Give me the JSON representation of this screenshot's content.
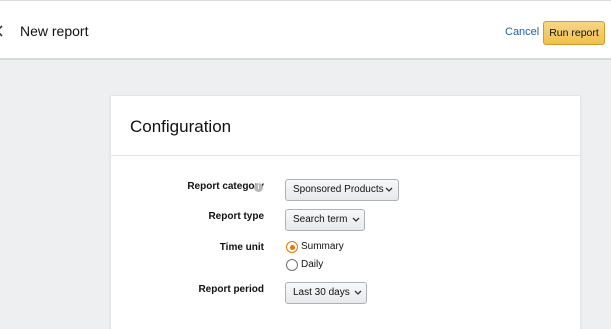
{
  "header": {
    "title": "New report",
    "cancel_label": "Cancel",
    "run_label": "Run report"
  },
  "config": {
    "title": "Configuration",
    "report_category": {
      "label": "Report category",
      "value": "Sponsored Products"
    },
    "report_type": {
      "label": "Report type",
      "value": "Search term"
    },
    "time_unit": {
      "label": "Time unit",
      "options": [
        {
          "label": "Summary",
          "selected": true
        },
        {
          "label": "Daily",
          "selected": false
        }
      ]
    },
    "report_period": {
      "label": "Report period",
      "value": "Last 30 days"
    }
  },
  "colors": {
    "run_button": "#f0c14b",
    "link": "#2162a1",
    "radio_selected": "#e77600"
  },
  "icons": [
    "chevron-left-icon",
    "info-icon",
    "chevron-down-icon"
  ]
}
